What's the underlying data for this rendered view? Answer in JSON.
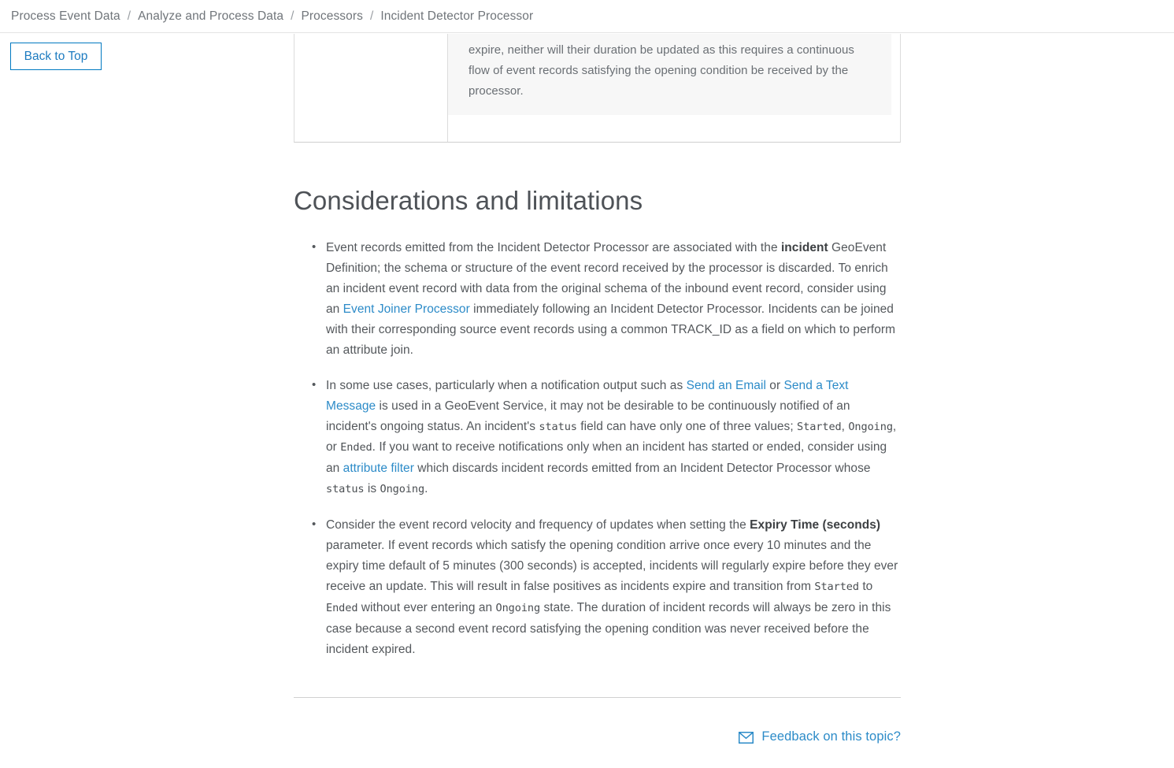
{
  "breadcrumb": {
    "separator": "/",
    "items": [
      "Process Event Data",
      "Analyze and Process Data",
      "Processors",
      "Incident Detector Processor"
    ]
  },
  "sidebar": {
    "back_to_top_label": "Back to Top"
  },
  "table_fragment": {
    "left_cell_text": "",
    "code_text": "expire, neither will their duration be updated as this requires a continuous flow of event records satisfying the opening condition be received by the processor."
  },
  "main": {
    "section_title": "Considerations and limitations",
    "bullets": {
      "b1": {
        "p1": "Event records emitted from the Incident Detector Processor are associated with the ",
        "bold1": "incident",
        "p2": " GeoEvent Definition; the schema or structure of the event record received by the processor is discarded. To enrich an incident event record with data from the original schema of the inbound event record, consider using an ",
        "link1": "Event Joiner Processor",
        "p3": " immediately following an Incident Detector Processor. Incidents can be joined with their corresponding source event records using a common TRACK_ID as a field on which to perform an attribute join."
      },
      "b2": {
        "p1": "In some use cases, particularly when a notification output such as ",
        "link1": "Send an Email",
        "p2": " or ",
        "link2": "Send a Text Message",
        "p3": " is used in a GeoEvent Service, it may not be desirable to be continuously notified of an incident's ongoing status. An incident's ",
        "code1": "status",
        "p4": " field can have only one of three values; ",
        "code2": "Started",
        "p5": ", ",
        "code3": "Ongoing",
        "p6": ", or ",
        "code4": "Ended",
        "p7": ". If you want to receive notifications only when an incident has started or ended, consider using an ",
        "link3": "attribute filter",
        "p8": " which discards incident records emitted from an Incident Detector Processor whose ",
        "code5": "status",
        "p9": " is ",
        "code6": "Ongoing",
        "p10": "."
      },
      "b3": {
        "p1": "Consider the event record velocity and frequency of updates when setting the ",
        "bold1": "Expiry Time (seconds)",
        "p2": " parameter. If event records which satisfy the opening condition arrive once every 10 minutes and the expiry time default of 5 minutes (300 seconds) is accepted, incidents will regularly expire before they ever receive an update. This will result in false positives as incidents expire and transition from ",
        "code1": "Started",
        "p3": " to ",
        "code2": "Ended",
        "p4": " without ever entering an ",
        "code3": "Ongoing",
        "p5": " state. The duration of incident records will always be zero in this case because a second event record satisfying the opening condition was never received before the incident expired."
      }
    }
  },
  "footer": {
    "feedback_label": "Feedback on this topic?",
    "feedback_icon": "mail-icon"
  },
  "colors": {
    "link": "#2c8bc8",
    "accent_border": "#0079c1",
    "body_text": "#54585c",
    "muted_text": "#70757a",
    "code_bg": "#f7f7f7"
  }
}
